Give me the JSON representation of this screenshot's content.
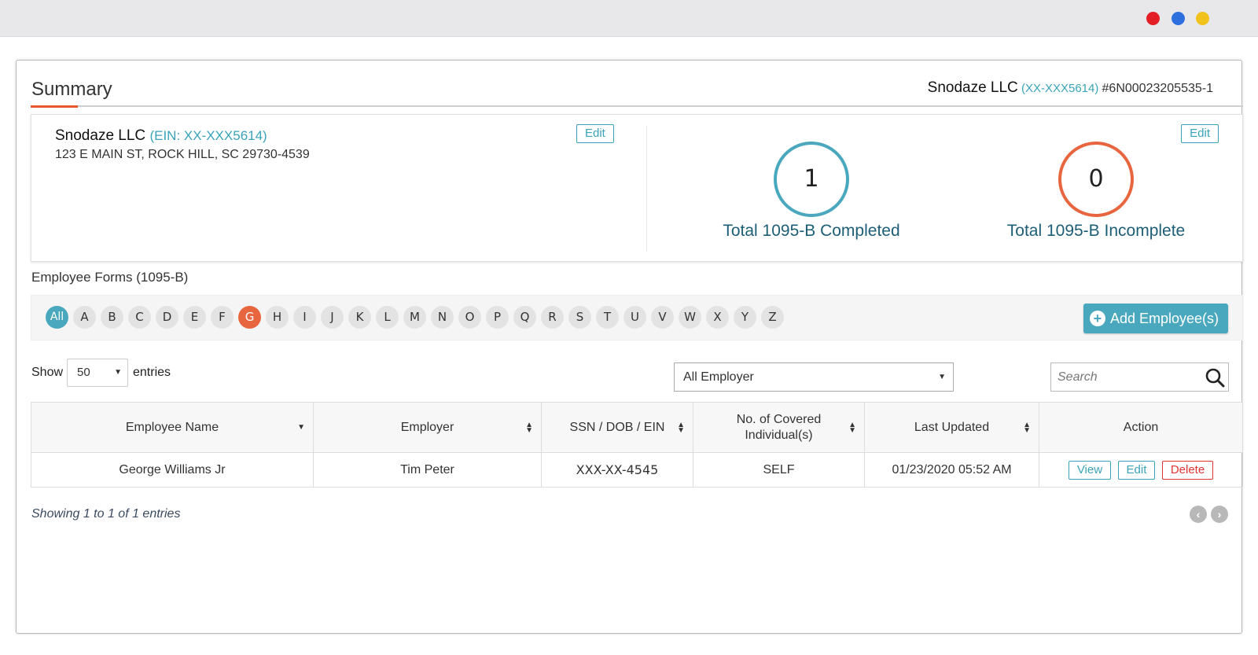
{
  "summary": {
    "title": "Summary",
    "header_company": "Snodaze LLC",
    "header_ein": "(XX-XXX5614)",
    "header_number": "#6N00023205535-1"
  },
  "company": {
    "name": "Snodaze LLC",
    "ein": "(EIN: XX-XXX5614)",
    "address": "123 E MAIN ST, ROCK HILL, SC 29730-4539",
    "edit_label": "Edit"
  },
  "stats": {
    "edit_label": "Edit",
    "completed_value": "1",
    "completed_label": "Total 1095-B Completed",
    "incomplete_value": "0",
    "incomplete_label": "Total 1095-B Incomplete"
  },
  "forms": {
    "title": "Employee Forms (1095-B)",
    "add_label": "Add Employee(s)",
    "alphabet": [
      "All",
      "A",
      "B",
      "C",
      "D",
      "E",
      "F",
      "G",
      "H",
      "I",
      "J",
      "K",
      "L",
      "M",
      "N",
      "O",
      "P",
      "Q",
      "R",
      "S",
      "T",
      "U",
      "V",
      "W",
      "X",
      "Y",
      "Z"
    ],
    "active_letter": "G"
  },
  "controls": {
    "show_label": "Show",
    "entries_value": "50",
    "entries_label": "entries",
    "employer_value": "All Employer",
    "search_placeholder": "Search"
  },
  "table": {
    "headers": [
      "Employee Name",
      "Employer",
      "SSN / DOB / EIN",
      "No. of Covered Individual(s)",
      "Last Updated",
      "Action"
    ],
    "rows": [
      {
        "employee_name": "George Williams Jr",
        "employer": "Tim Peter",
        "ssn": "XXX-XX-4545",
        "covered": "SELF",
        "last_updated": "01/23/2020 05:52 AM",
        "actions": {
          "view": "View",
          "edit": "Edit",
          "delete": "Delete"
        }
      }
    ]
  },
  "footer": {
    "showing": "Showing 1 to 1 of 1 entries"
  },
  "colors": {
    "accent_teal": "#49a8bd",
    "accent_orange": "#e8663f",
    "delete_red": "#e23333"
  }
}
